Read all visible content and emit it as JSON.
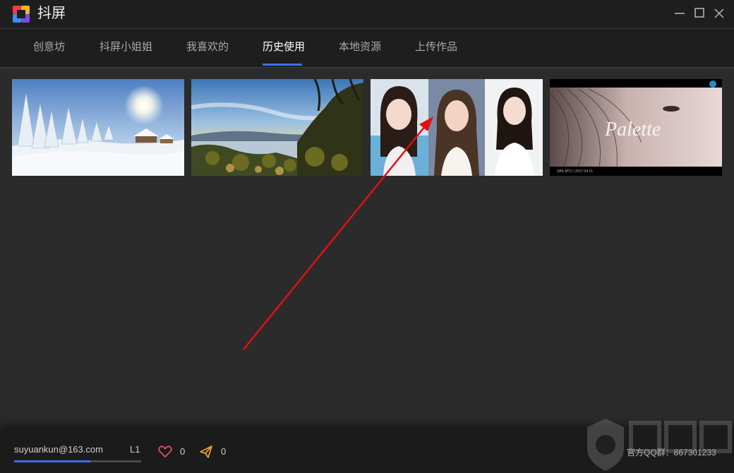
{
  "app": {
    "title": "抖屏"
  },
  "tabs": [
    {
      "label": "创意坊",
      "active": false
    },
    {
      "label": "抖屏小姐姐",
      "active": false
    },
    {
      "label": "我喜欢的",
      "active": false
    },
    {
      "label": "历史使用",
      "active": true
    },
    {
      "label": "本地资源",
      "active": false
    },
    {
      "label": "上传作品",
      "active": false
    }
  ],
  "thumbnails": [
    {
      "subject": "snowy winter landscape with sun"
    },
    {
      "subject": "sunset over lake with pine trees"
    },
    {
      "subject": "three portrait photos of a young woman"
    },
    {
      "subject": "close-up of hair with script text",
      "overlay_text": "Palette",
      "caption": "SBS MTV | 2017.04.21"
    }
  ],
  "footer": {
    "email": "suyuankun@163.com",
    "level": "L1",
    "level_progress": 0.6,
    "likes_count": "0",
    "shares_count": "0",
    "qq_group": "官方QQ群：867301233"
  },
  "colors": {
    "accent": "#3b6ff5",
    "annotation_arrow": "#e01010",
    "like_icon": "#e05060",
    "share_icon": "#e8a030"
  },
  "icons": {
    "like": "heart-icon",
    "share": "paper-plane-icon",
    "minimize": "minimize-icon",
    "maximize": "maximize-icon",
    "close": "close-icon"
  }
}
